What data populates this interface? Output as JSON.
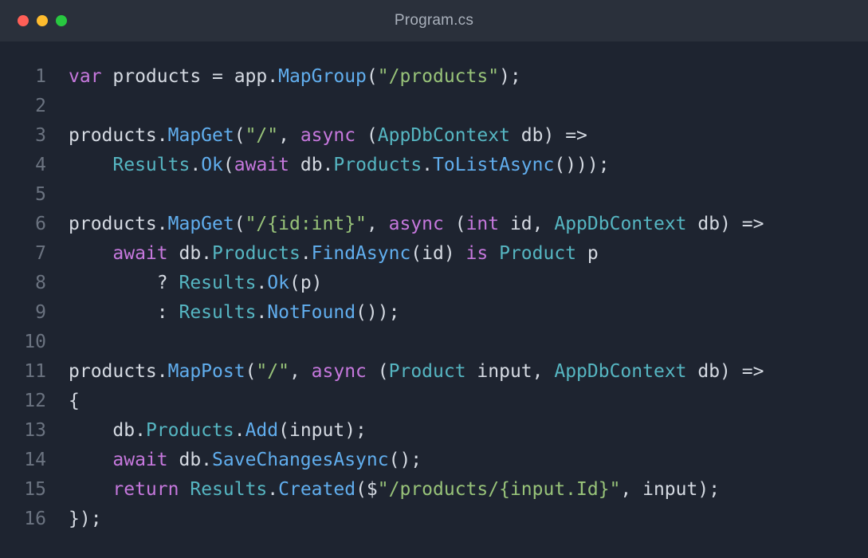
{
  "window": {
    "title": "Program.cs",
    "buttons": [
      {
        "name": "close-button",
        "color": "#ff5f57"
      },
      {
        "name": "minimize-button",
        "color": "#febc2e"
      },
      {
        "name": "maximize-button",
        "color": "#28c840"
      }
    ]
  },
  "colors": {
    "keyword": "#c678dd",
    "method": "#61aeee",
    "type": "#56b6c2",
    "string": "#98c379",
    "plain": "#d5dae2",
    "line_number": "#6b7380"
  },
  "editor": {
    "lines": [
      {
        "number": "1",
        "tokens": [
          {
            "t": "var",
            "k": "keyword"
          },
          {
            "t": " products = app.",
            "k": "plain"
          },
          {
            "t": "MapGroup",
            "k": "method"
          },
          {
            "t": "(",
            "k": "plain"
          },
          {
            "t": "\"/products\"",
            "k": "string"
          },
          {
            "t": ");",
            "k": "plain"
          }
        ]
      },
      {
        "number": "2",
        "tokens": []
      },
      {
        "number": "3",
        "tokens": [
          {
            "t": "products.",
            "k": "plain"
          },
          {
            "t": "MapGet",
            "k": "method"
          },
          {
            "t": "(",
            "k": "plain"
          },
          {
            "t": "\"/\"",
            "k": "string"
          },
          {
            "t": ", ",
            "k": "plain"
          },
          {
            "t": "async",
            "k": "keyword"
          },
          {
            "t": " (",
            "k": "plain"
          },
          {
            "t": "AppDbContext",
            "k": "type"
          },
          {
            "t": " db) =>",
            "k": "plain"
          }
        ]
      },
      {
        "number": "4",
        "tokens": [
          {
            "t": "    ",
            "k": "plain"
          },
          {
            "t": "Results",
            "k": "type"
          },
          {
            "t": ".",
            "k": "plain"
          },
          {
            "t": "Ok",
            "k": "method"
          },
          {
            "t": "(",
            "k": "plain"
          },
          {
            "t": "await",
            "k": "keyword"
          },
          {
            "t": " db.",
            "k": "plain"
          },
          {
            "t": "Products",
            "k": "type"
          },
          {
            "t": ".",
            "k": "plain"
          },
          {
            "t": "ToListAsync",
            "k": "method"
          },
          {
            "t": "()));",
            "k": "plain"
          }
        ]
      },
      {
        "number": "5",
        "tokens": []
      },
      {
        "number": "6",
        "tokens": [
          {
            "t": "products.",
            "k": "plain"
          },
          {
            "t": "MapGet",
            "k": "method"
          },
          {
            "t": "(",
            "k": "plain"
          },
          {
            "t": "\"/{id:int}\"",
            "k": "string"
          },
          {
            "t": ", ",
            "k": "plain"
          },
          {
            "t": "async",
            "k": "keyword"
          },
          {
            "t": " (",
            "k": "plain"
          },
          {
            "t": "int",
            "k": "keyword"
          },
          {
            "t": " id, ",
            "k": "plain"
          },
          {
            "t": "AppDbContext",
            "k": "type"
          },
          {
            "t": " db) =>",
            "k": "plain"
          }
        ]
      },
      {
        "number": "7",
        "tokens": [
          {
            "t": "    ",
            "k": "plain"
          },
          {
            "t": "await",
            "k": "keyword"
          },
          {
            "t": " db.",
            "k": "plain"
          },
          {
            "t": "Products",
            "k": "type"
          },
          {
            "t": ".",
            "k": "plain"
          },
          {
            "t": "FindAsync",
            "k": "method"
          },
          {
            "t": "(id) ",
            "k": "plain"
          },
          {
            "t": "is",
            "k": "keyword"
          },
          {
            "t": " ",
            "k": "plain"
          },
          {
            "t": "Product",
            "k": "type"
          },
          {
            "t": " p",
            "k": "plain"
          }
        ]
      },
      {
        "number": "8",
        "tokens": [
          {
            "t": "        ? ",
            "k": "plain"
          },
          {
            "t": "Results",
            "k": "type"
          },
          {
            "t": ".",
            "k": "plain"
          },
          {
            "t": "Ok",
            "k": "method"
          },
          {
            "t": "(p)",
            "k": "plain"
          }
        ]
      },
      {
        "number": "9",
        "tokens": [
          {
            "t": "        : ",
            "k": "plain"
          },
          {
            "t": "Results",
            "k": "type"
          },
          {
            "t": ".",
            "k": "plain"
          },
          {
            "t": "NotFound",
            "k": "method"
          },
          {
            "t": "());",
            "k": "plain"
          }
        ]
      },
      {
        "number": "10",
        "tokens": []
      },
      {
        "number": "11",
        "tokens": [
          {
            "t": "products.",
            "k": "plain"
          },
          {
            "t": "MapPost",
            "k": "method"
          },
          {
            "t": "(",
            "k": "plain"
          },
          {
            "t": "\"/\"",
            "k": "string"
          },
          {
            "t": ", ",
            "k": "plain"
          },
          {
            "t": "async",
            "k": "keyword"
          },
          {
            "t": " (",
            "k": "plain"
          },
          {
            "t": "Product",
            "k": "type"
          },
          {
            "t": " input, ",
            "k": "plain"
          },
          {
            "t": "AppDbContext",
            "k": "type"
          },
          {
            "t": " db) =>",
            "k": "plain"
          }
        ]
      },
      {
        "number": "12",
        "tokens": [
          {
            "t": "{",
            "k": "plain"
          }
        ]
      },
      {
        "number": "13",
        "tokens": [
          {
            "t": "    db.",
            "k": "plain"
          },
          {
            "t": "Products",
            "k": "type"
          },
          {
            "t": ".",
            "k": "plain"
          },
          {
            "t": "Add",
            "k": "method"
          },
          {
            "t": "(input);",
            "k": "plain"
          }
        ]
      },
      {
        "number": "14",
        "tokens": [
          {
            "t": "    ",
            "k": "plain"
          },
          {
            "t": "await",
            "k": "keyword"
          },
          {
            "t": " db.",
            "k": "plain"
          },
          {
            "t": "SaveChangesAsync",
            "k": "method"
          },
          {
            "t": "();",
            "k": "plain"
          }
        ]
      },
      {
        "number": "15",
        "tokens": [
          {
            "t": "    ",
            "k": "plain"
          },
          {
            "t": "return",
            "k": "keyword"
          },
          {
            "t": " ",
            "k": "plain"
          },
          {
            "t": "Results",
            "k": "type"
          },
          {
            "t": ".",
            "k": "plain"
          },
          {
            "t": "Created",
            "k": "method"
          },
          {
            "t": "($",
            "k": "plain"
          },
          {
            "t": "\"/products/{input.Id}\"",
            "k": "string"
          },
          {
            "t": ", input);",
            "k": "plain"
          }
        ]
      },
      {
        "number": "16",
        "tokens": [
          {
            "t": "});",
            "k": "plain"
          }
        ]
      }
    ]
  }
}
